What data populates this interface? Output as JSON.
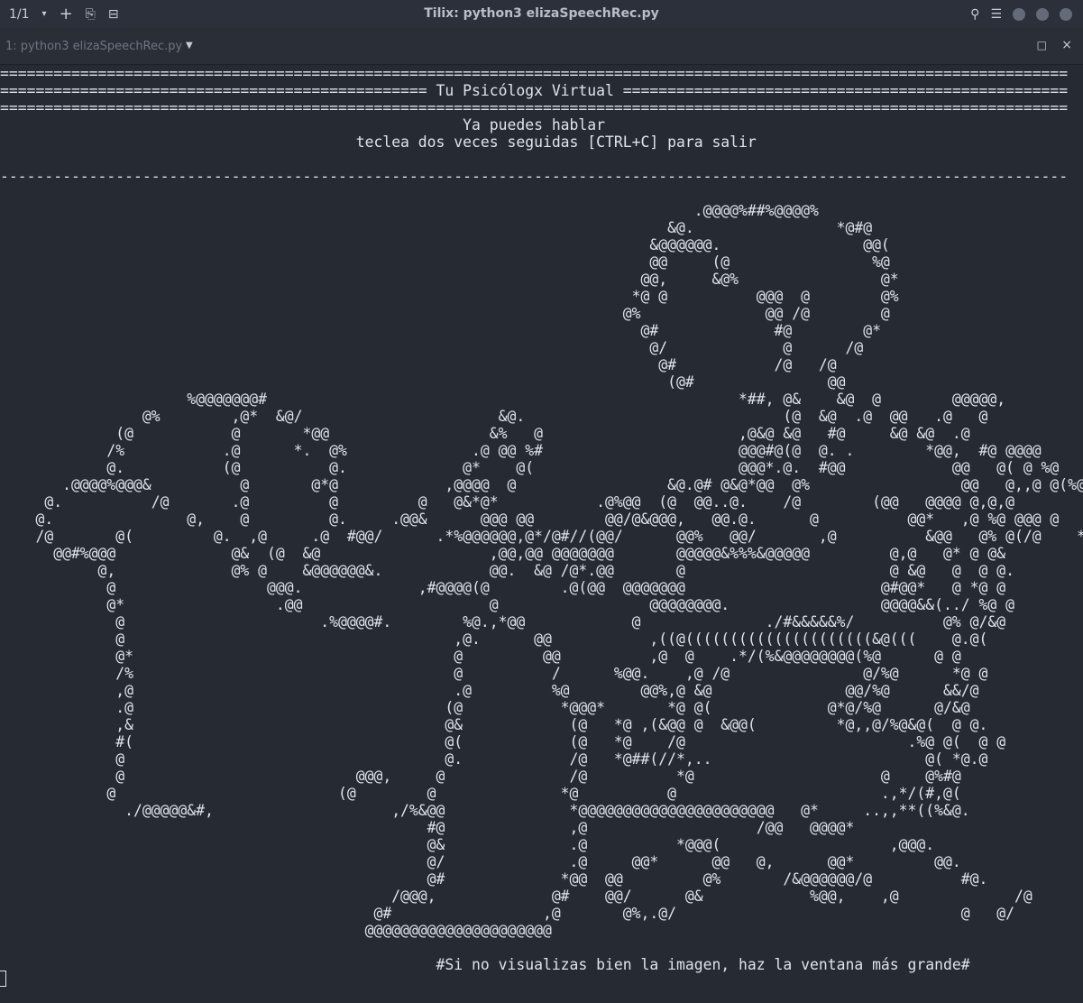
{
  "titlebar": {
    "session_counter": "1/1",
    "window_title": "Tilix: python3 elizaSpeechRec.py"
  },
  "tab": {
    "label": "1: python3 elizaSpeechRec.py"
  },
  "terminal": {
    "lines": [
      "========================================================================================================================",
      "================================================ Tu Psicólogx Virtual ==================================================",
      "========================================================================================================================",
      "                                                    Ya puedes hablar",
      "                                        teclea dos veces seguidas [CTRL+C] para salir",
      "",
      "------------------------------------------------------------------------------------------------------------------------",
      "",
      "                                                                              .@@@@%##%@@@@%",
      "                                                                           &@.                *@#@",
      "                                                                         &@@@@@@.                @@(",
      "                                                                         @@     (@                %@",
      "                                                                        @@,     &@%                @*",
      "                                                                       *@ @          @@@  @        @%",
      "                                                                      @%              @@ /@        @",
      "                                                                        @#             #@        @*",
      "                                                                         @/             @      /@",
      "                                                                          @#           /@   /@",
      "                                                                           (@#               @@",
      "                     %@@@@@@@#                                                     *##, @&    &@  @        @@@@@,",
      "                @%        ,@*  &@/                      &@.                             (@  &@  .@  @@   .@   @",
      "             (@           @       *@@                  &%   @                      ,@&@ &@   #@     &@ &@  .@",
      "            /%           .@      *.  @%              .@ @@ %#                      @@@#@(@  @. .        *@@,  #@ @@@@",
      "            @.           (@          @.             @*    @(                       @@@*.@.  #@@            @@   @( @ %@",
      "       .@@@@%@@@&          @       @*@            ,@@@@  @                 &@.@# @&@*@@  @%                 @@   @,,@ @(%@@,",
      "     @.          /@       .@         @         @   @&*@*           .@%@@  (@  @@..@.    /@        (@@   @@@@ @,@,@",
      "    @.               @,    @         @.     .@@&      @@@ @@        @@/@&@@@,   @@.@.      @          @@*   ,@ %@ @@@ @",
      "    /@       @(         @.  ,@     .@  #@@/      .*%@@@@@@,@*/@#//(@@/      @@%   @@/       ,@          &@@   @% @(/@    *",
      "      @@#%@@@             @&  (@  &@                   ,@@,@@ @@@@@@@       @@@@@&%%%&@@@@@         @,@   @* @ @&",
      "           @,             @% @    &@@@@@@&.            @@.  &@ /@*.@@       @                       @ &@   @  @ @.",
      "            @                 @@@.             ,#@@@@(@        .@(@@  @@@@@@@                      @#@@*   @ *@ @",
      "            @*                 .@@                     @                 @@@@@@@@.                 @@@@&&(../ %@ @",
      "             @                      .%@@@@#.        %@.,*@@            @              ./#&&&&&%/          @% @/&@",
      "             @                                     ,@.      @@           ,((@(((((((((((((((((((((&@(((    @.@(",
      "             @*                                    @         @@          ,@  @    .*/(%&@@@@@@@@(%@      @ @",
      "             /%                                    @          /      %@@.    ,@ /@               @/%@      *@ @",
      "             ,@                                    .@         %@        @@%,@ &@               @@/%@      &&/@",
      "             .@                                   (@           *@@@*       *@ @(             @*@/%@      @/&@",
      "             ,&                                   @&            (@   *@ ,(&@@ @  &@@(         *@,,@/%@&@(  @ @.",
      "             #(                                   @(            (@   *@    /@                         .%@ @(  @ @",
      "             @                                    @.            /@   *@##(//*,..                        @( *@.@",
      "             @                          @@@,     @              /@          *@                     @    @%#@",
      "            @                         (@        @              *@          @                       .,*/(#,@(",
      "              ./@@@@@&#,                    ,/%&@@              *@@@@@@@@@@@@@@@@@@@@@@   @*     ..,,**((%&@.",
      "                                                #@              ,@                   /@@   @@@@*",
      "                                                @&              .@          *@@@(                   ,@@@.",
      "                                                @/              .@     @@*      @@   @,      @@*         @@.",
      "                                                @#             *@@  @@         @%       /&@@@@@@/@          #@.",
      "                                            /@@@,             @#    @@/      @&            %@@,    ,@             /@",
      "                                          @#                 ,@       @%,.@/                                @   @/",
      "                                         @@@@@@@@@@@@@@@@@@@@@",
      "",
      "                                                 #Si no visualizas bien la imagen, haz la ventana más grande#"
    ]
  }
}
